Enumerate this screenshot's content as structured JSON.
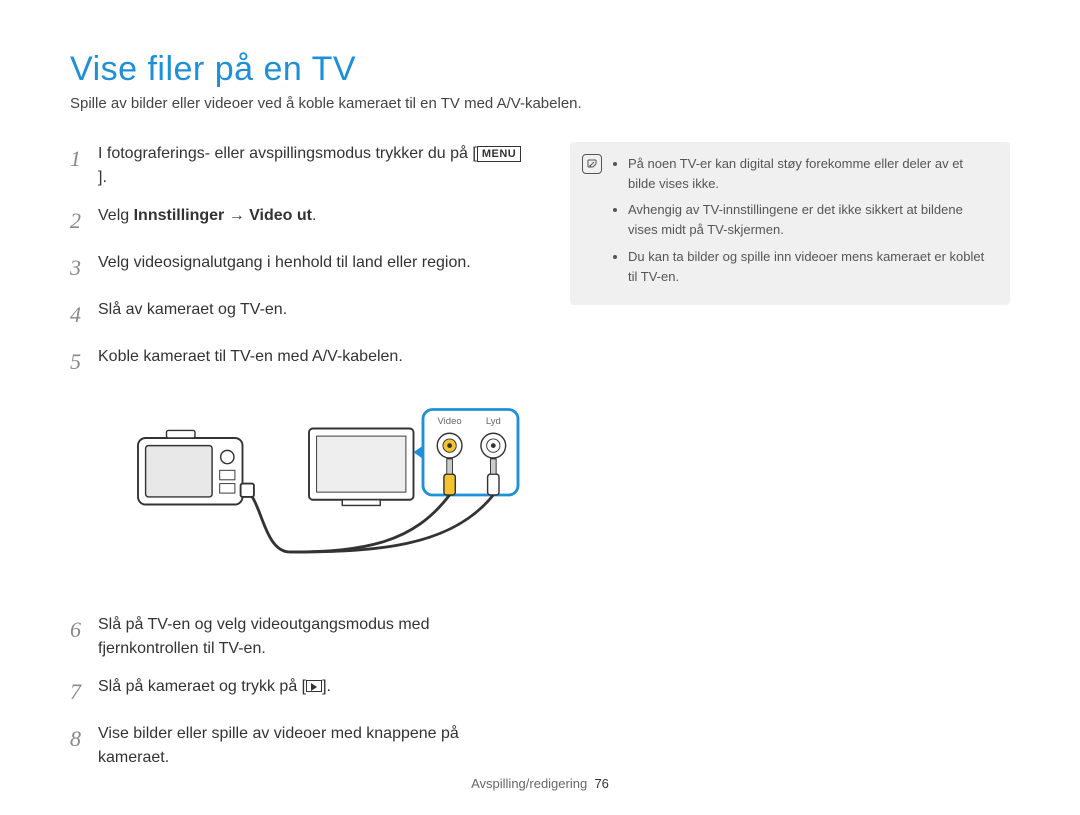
{
  "title": "Vise filer på en TV",
  "subtitle": "Spille av bilder eller videoer ved å koble kameraet til en TV med A/V-kabelen.",
  "steps": {
    "s1a": "I fotograferings- eller avspillingsmodus trykker du på [",
    "s1b": "MENU",
    "s1c": "].",
    "s2a": "Velg ",
    "s2b": "Innstillinger",
    "s2c": " → ",
    "s2d": "Video ut",
    "s2e": ".",
    "s3": "Velg videosignalutgang i henhold til land eller region.",
    "s4": "Slå av kameraet og TV-en.",
    "s5": "Koble kameraet til TV-en med A/V-kabelen.",
    "s6": "Slå på TV-en og velg videoutgangsmodus med fjernkontrollen til TV-en.",
    "s7a": "Slå på kameraet og trykk på [",
    "s7b": "].",
    "s8": "Vise bilder eller spille av videoer med knappene på kameraet."
  },
  "diagram": {
    "video": "Video",
    "audio": "Lyd"
  },
  "notes": {
    "n1": "På noen TV-er kan digital støy forekomme eller deler av et bilde vises ikke.",
    "n2": "Avhengig av TV-innstillingene er det ikke sikkert at bildene vises midt på TV-skjermen.",
    "n3": "Du kan ta bilder og spille inn videoer mens kameraet er koblet til TV-en."
  },
  "footer": {
    "section": "Avspilling/redigering",
    "page": "76"
  }
}
